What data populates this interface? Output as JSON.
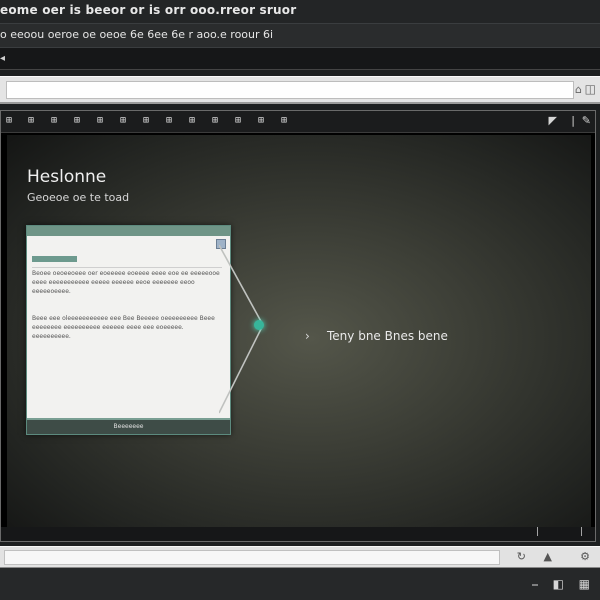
{
  "window": {
    "title_line": "eome oer is beeor or is orr ooo.rreor sruor",
    "subtitle_line": "o eeoou oeroe oe oeoe 6e 6ee 6e r aoo.e roour 6i"
  },
  "viewer": {
    "tool_icons": [
      "grid-icon",
      "grid-icon",
      "grid-icon",
      "grid-icon",
      "grid-icon",
      "grid-icon",
      "grid-icon",
      "grid-icon",
      "grid-icon",
      "grid-icon",
      "grid-icon",
      "grid-icon",
      "grid-icon"
    ],
    "title": "Heslonne",
    "subtitle": "Geoeoe oe te toad",
    "right_label": "Teny bne Bnes bene",
    "panel": {
      "para1": "Beoee oeoeeoeee oer eoeeeee eoeeee eeee eoe ee eeeeeooe eeee eeeeeeeeeee eeeee eeeeee eeoe eeeeeee eeoo eeeeeoeeee.",
      "para2": "Beee eee oleeeeeeeeeee eee Bee Beeeee oeeeeeeeee Beee eeeeeeee eeeeeeeeee eeeeee eeee eee eoeeeee. eeeeeeeeee.",
      "footer": "Beeeeeee"
    }
  }
}
